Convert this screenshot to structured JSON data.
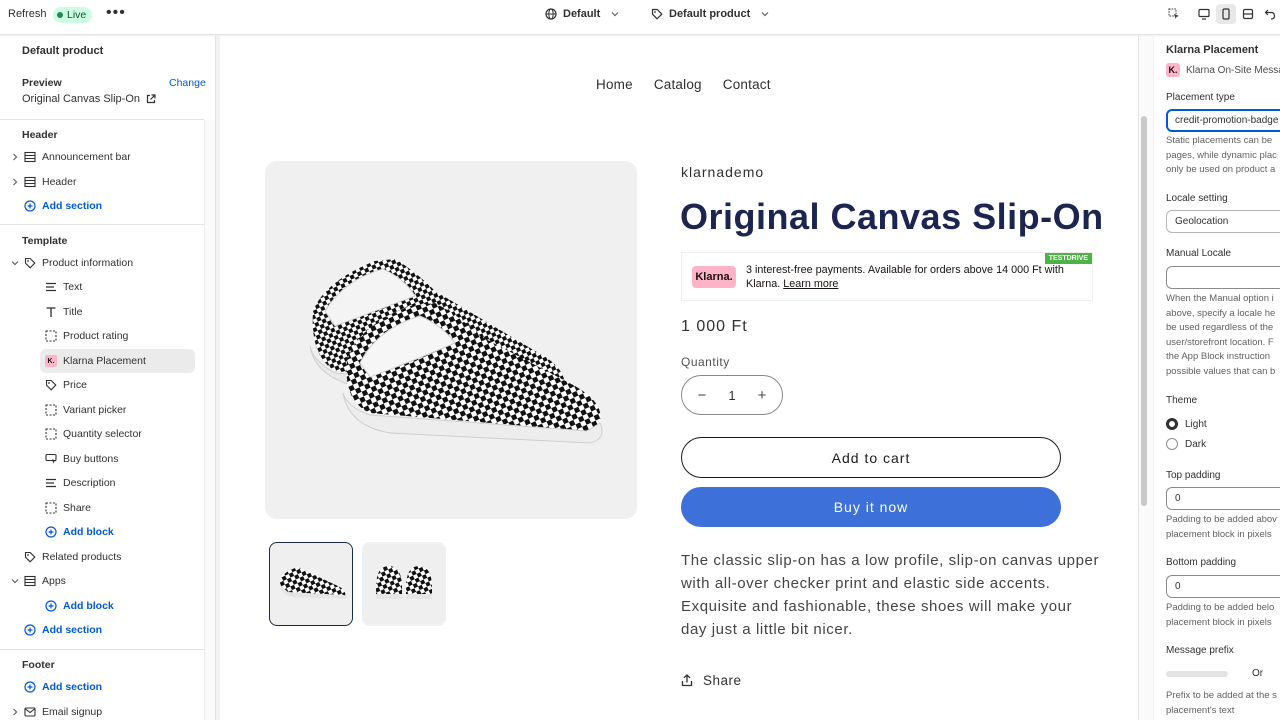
{
  "topbar": {
    "refresh": "Refresh",
    "live": "Live",
    "more": "•••",
    "theme_select": "Default",
    "template_select": "Default product"
  },
  "left": {
    "title": "Default product",
    "preview_label": "Preview",
    "preview_change": "Change",
    "preview_value": "Original Canvas Slip-On",
    "header_section": "Header",
    "header_items": [
      "Announcement bar",
      "Header"
    ],
    "add_section": "Add section",
    "template_section": "Template",
    "product_information": "Product information",
    "blocks": [
      "Text",
      "Title",
      "Product rating",
      "Klarna Placement",
      "Price",
      "Variant picker",
      "Quantity selector",
      "Buy buttons",
      "Description",
      "Share"
    ],
    "add_block": "Add block",
    "related_products": "Related products",
    "apps": "Apps",
    "footer_section": "Footer",
    "email_signup": "Email signup"
  },
  "preview": {
    "nav": [
      "Home",
      "Catalog",
      "Contact"
    ],
    "vendor": "klarnademo",
    "title": "Original Canvas Slip-On",
    "klarna_logo": "Klarna.",
    "klarna_text": "3 interest-free payments. Available for orders above 14 000 Ft with Klarna.",
    "klarna_link": "Learn more",
    "testdrive": "TESTDRIVE",
    "price": "1 000 Ft",
    "quantity_label": "Quantity",
    "quantity_value": "1",
    "minus": "−",
    "plus": "+",
    "add_to_cart": "Add to cart",
    "buy_now": "Buy it now",
    "description": "The classic slip-on has a low profile, slip-on canvas upper with all-over checker print and elastic side accents. Exquisite and fashionable, these shoes will make your day just a little bit nicer.",
    "share": "Share"
  },
  "right": {
    "title": "Klarna Placement",
    "app_name": "Klarna On-Site Messa",
    "app_badge": "K.",
    "placement_type_label": "Placement type",
    "placement_type_value": "credit-promotion-badge",
    "placement_help": [
      "Static placements can be",
      "pages, while dynamic plac",
      "only be used on product a"
    ],
    "locale_label": "Locale setting",
    "locale_value": "Geolocation",
    "manual_locale_label": "Manual Locale",
    "manual_locale_value": "",
    "manual_help": [
      "When the Manual option i",
      "above, specify a locale he",
      "be used regardless of the",
      "user/storefront location. F",
      "the App Block instruction",
      "possible values that can b"
    ],
    "theme_label": "Theme",
    "theme_options": [
      "Light",
      "Dark"
    ],
    "top_padding_label": "Top padding",
    "top_padding_value": "0",
    "top_help": [
      "Padding to be added abov",
      "placement block in pixels"
    ],
    "bottom_padding_label": "Bottom padding",
    "bottom_padding_value": "0",
    "bottom_help": [
      "Padding to be added belo",
      "placement block in pixels"
    ],
    "message_prefix_label": "Message prefix",
    "message_prefix_value": "Or",
    "prefix_help": [
      "Prefix to be added at the s",
      "placement's text"
    ]
  },
  "colors": {
    "accent": "#005bd3",
    "buy_button": "#3d71d9",
    "klarna_pink": "#ffb3c7",
    "live_green": "#29845a",
    "title_navy": "#1b2550"
  }
}
